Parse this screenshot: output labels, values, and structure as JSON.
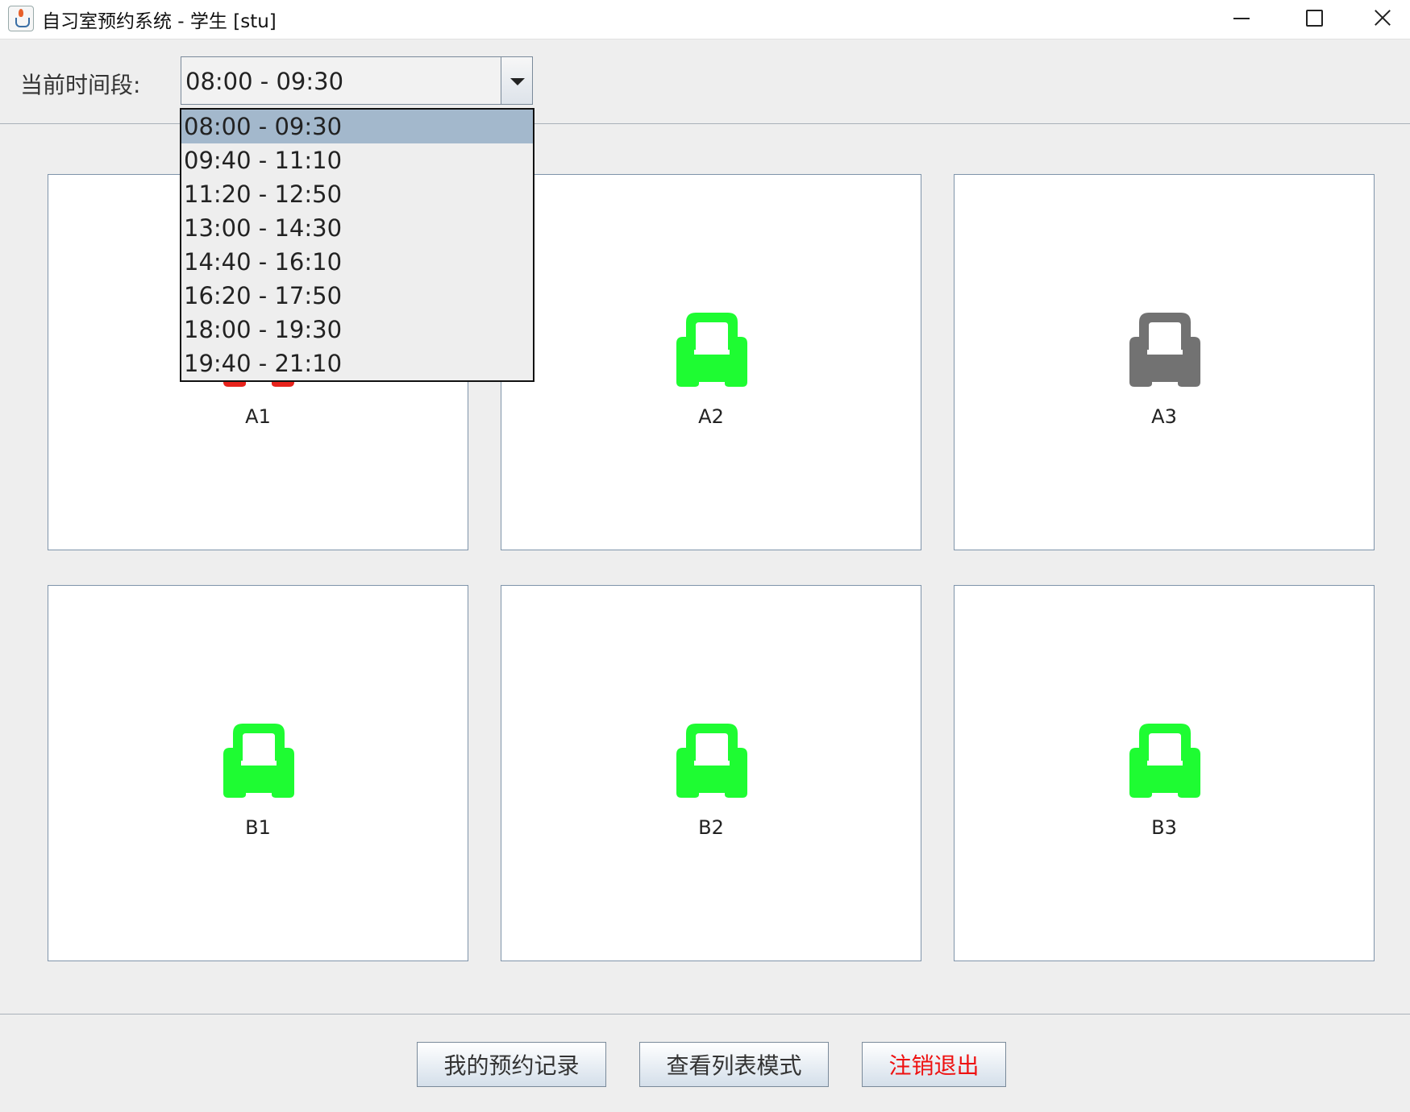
{
  "window": {
    "title": "自习室预约系统 - 学生 [stu]",
    "icon": "java-cup-icon"
  },
  "period": {
    "label": "当前时间段:",
    "selected": "08:00 - 09:30",
    "options": [
      "08:00 - 09:30",
      "09:40 - 11:10",
      "11:20 - 12:50",
      "13:00 - 14:30",
      "14:40 - 16:10",
      "16:20 - 17:50",
      "18:00 - 19:30",
      "19:40 - 21:10"
    ]
  },
  "rooms": [
    {
      "name": "A1",
      "status_color": "#e8231c"
    },
    {
      "name": "A2",
      "status_color": "#1efc32"
    },
    {
      "name": "A3",
      "status_color": "#727272"
    },
    {
      "name": "B1",
      "status_color": "#1efc32"
    },
    {
      "name": "B2",
      "status_color": "#1efc32"
    },
    {
      "name": "B3",
      "status_color": "#1efc32"
    }
  ],
  "buttons": {
    "records": "我的预约记录",
    "list_mode": "查看列表模式",
    "logout": "注销退出"
  },
  "colors": {
    "logout_text": "#ee1111",
    "selected_option_bg": "#a3b8cc"
  }
}
